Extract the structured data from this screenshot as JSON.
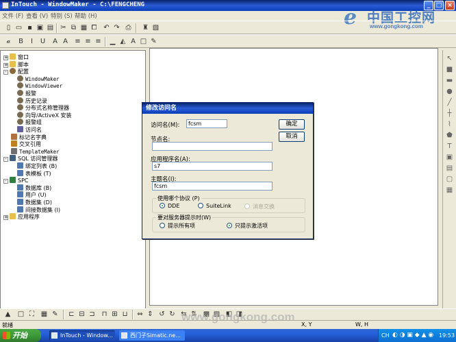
{
  "window": {
    "title": "InTouch - WindowMaker - C:\\FENGCHENG"
  },
  "logo": {
    "cn_text": "中国工控网",
    "url": "www.gongkong.com"
  },
  "menubar": {
    "items": [
      "文件 (F)",
      "查看 (V)",
      "特别 (S)",
      "帮助 (H)"
    ]
  },
  "tree": {
    "items": [
      {
        "label": "窗口",
        "level": 0,
        "expander": "+",
        "icon": "folder"
      },
      {
        "label": "脚本",
        "level": 0,
        "expander": "+",
        "icon": "folder"
      },
      {
        "label": "配置",
        "level": 0,
        "expander": "-",
        "icon": "gears"
      },
      {
        "label": "WindowMaker",
        "level": 1,
        "expander": "",
        "icon": "gear",
        "mono": true
      },
      {
        "label": "WindowViewer",
        "level": 1,
        "expander": "",
        "icon": "gear",
        "mono": true
      },
      {
        "label": "报警",
        "level": 1,
        "expander": "",
        "icon": "gear"
      },
      {
        "label": "历史记录",
        "level": 1,
        "expander": "",
        "icon": "gear"
      },
      {
        "label": "分布式名称管理器",
        "level": 1,
        "expander": "",
        "icon": "gear"
      },
      {
        "label": "向导/ActiveX 安装",
        "level": 1,
        "expander": "",
        "icon": "gear"
      },
      {
        "label": "报警组",
        "level": 1,
        "expander": "",
        "icon": "gear"
      },
      {
        "label": "访问名",
        "level": 1,
        "expander": "",
        "icon": "wand"
      },
      {
        "label": "标记名字典",
        "level": 0,
        "expander": "",
        "icon": "dict"
      },
      {
        "label": "交叉引用",
        "level": 0,
        "expander": "",
        "icon": "xref"
      },
      {
        "label": "TemplateMaker",
        "level": 0,
        "expander": "",
        "icon": "template",
        "mono": true
      },
      {
        "label": "SQL 访问管理器",
        "level": 0,
        "expander": "-",
        "icon": "db"
      },
      {
        "label": "绑定列表 (B)",
        "level": 1,
        "expander": "",
        "icon": "table"
      },
      {
        "label": "表模板 (T)",
        "level": 1,
        "expander": "",
        "icon": "table"
      },
      {
        "label": "SPC",
        "level": 0,
        "expander": "-",
        "icon": "chart"
      },
      {
        "label": "数据库 (B)",
        "level": 1,
        "expander": "",
        "icon": "table"
      },
      {
        "label": "用户 (U)",
        "level": 1,
        "expander": "",
        "icon": "table"
      },
      {
        "label": "数据集 (D)",
        "level": 1,
        "expander": "",
        "icon": "table"
      },
      {
        "label": "间接数据集 (I)",
        "level": 1,
        "expander": "",
        "icon": "table"
      },
      {
        "label": "应用程序",
        "level": 0,
        "expander": "+",
        "icon": "folder"
      }
    ]
  },
  "dialog": {
    "title": "修改访问名",
    "access_name_label": "访问名(M):",
    "access_name_value": "fcsm",
    "node_name_label": "节点名:",
    "node_name_value": "",
    "app_name_label": "应用程序名(A):",
    "app_name_value": "s7",
    "topic_name_label": "主题名(I):",
    "topic_name_value": "fcsm",
    "ok_label": "确定",
    "cancel_label": "取消",
    "protocol_group_label": "使用哪个协议 (P)",
    "protocol_options": [
      "DDE",
      "SuiteLink",
      "消息交换"
    ],
    "protocol_selected": "DDE",
    "advise_group_label": "要对服务器提示时(W)",
    "advise_options": [
      "提示所有项",
      "只提示激活项"
    ],
    "advise_selected": "只提示激活项"
  },
  "statusbar": {
    "text": "就绪",
    "x_label": "X, Y",
    "w_label": "W, H"
  },
  "taskbar": {
    "start_label": "开始",
    "tasks": [
      "InTouch - Window...",
      "西门子Simatic.ne..."
    ],
    "tray_ime": "CH",
    "clock": "19:53"
  },
  "watermark": "www.gongkong.com"
}
